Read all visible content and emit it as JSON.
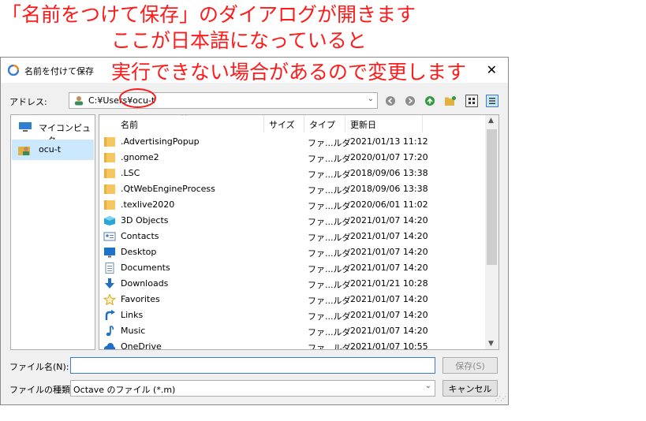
{
  "annotation": {
    "line1": "「名前をつけて保存」のダイアログが開きます",
    "line2": "ここが日本語になっていると",
    "line3": "実行できない場合があるので変更します",
    "color": "#ff1a1a"
  },
  "dialog": {
    "title": "名前を付けて保存",
    "close_icon": "close-icon"
  },
  "address": {
    "label": "アドレス:",
    "path": "C:¥Users¥ocu-t"
  },
  "sidebar": {
    "items": [
      {
        "label": "マイコンピュータ",
        "icon": "computer-icon"
      },
      {
        "label": "ocu-t",
        "icon": "user-folder-icon",
        "selected": true
      }
    ]
  },
  "columns": {
    "name": "名前",
    "size": "サイズ",
    "type": "タイプ",
    "date": "更新日"
  },
  "files": [
    {
      "name": ".AdvertisingPopup",
      "type": "ファ...ルダ",
      "date": "2021/01/13 11:12",
      "icon": "folder-icon"
    },
    {
      "name": ".gnome2",
      "type": "ファ...ルダ",
      "date": "2020/01/07 17:20",
      "icon": "folder-icon"
    },
    {
      "name": ".LSC",
      "type": "ファ...ルダ",
      "date": "2018/09/06 13:38",
      "icon": "folder-icon"
    },
    {
      "name": ".QtWebEngineProcess",
      "type": "ファ...ルダ",
      "date": "2018/09/06 13:38",
      "icon": "folder-icon"
    },
    {
      "name": ".texlive2020",
      "type": "ファ...ルダ",
      "date": "2020/06/01 11:02",
      "icon": "folder-icon"
    },
    {
      "name": "3D Objects",
      "type": "ファ...ルダ",
      "date": "2021/01/07 14:20",
      "icon": "3d-objects-icon"
    },
    {
      "name": "Contacts",
      "type": "ファ...ルダ",
      "date": "2021/01/07 14:20",
      "icon": "contacts-icon"
    },
    {
      "name": "Desktop",
      "type": "ファ...ルダ",
      "date": "2021/01/07 14:20",
      "icon": "desktop-icon"
    },
    {
      "name": "Documents",
      "type": "ファ...ルダ",
      "date": "2021/01/07 14:20",
      "icon": "documents-icon"
    },
    {
      "name": "Downloads",
      "type": "ファ...ルダ",
      "date": "2021/01/21 10:28",
      "icon": "downloads-icon"
    },
    {
      "name": "Favorites",
      "type": "ファ...ルダ",
      "date": "2021/01/07 14:20",
      "icon": "favorites-icon"
    },
    {
      "name": "Links",
      "type": "ファ...ルダ",
      "date": "2021/01/07 14:20",
      "icon": "links-icon"
    },
    {
      "name": "Music",
      "type": "ファ...ルダ",
      "date": "2021/01/07 14:20",
      "icon": "music-icon"
    },
    {
      "name": "OneDrive",
      "type": "ファ...ルダ",
      "date": "2021/01/07 10:55",
      "icon": "onedrive-icon"
    }
  ],
  "filename": {
    "label": "ファイル名(N):",
    "value": ""
  },
  "filetype": {
    "label": "ファイルの種類:",
    "value": "Octave のファイル (*.m)"
  },
  "buttons": {
    "save": "保存(S)",
    "cancel": "キャンセル"
  }
}
